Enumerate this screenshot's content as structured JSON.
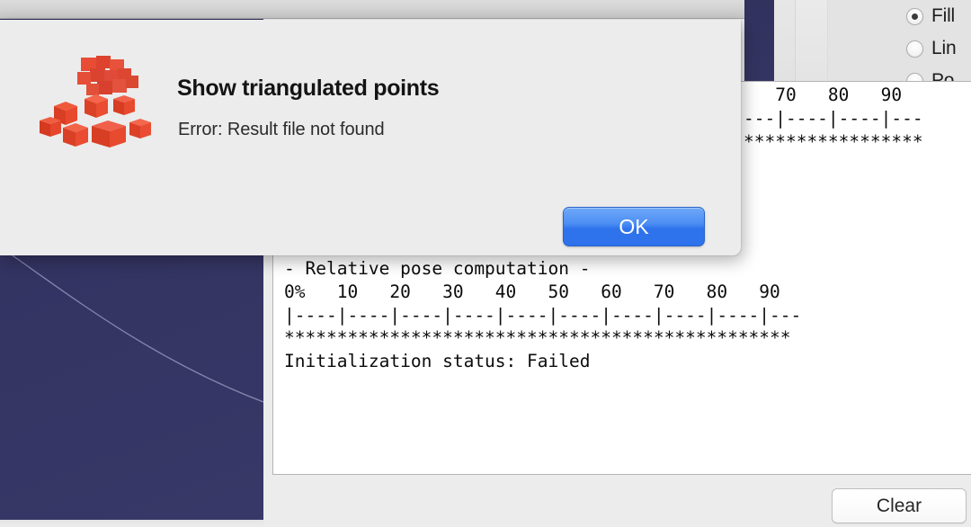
{
  "dialog": {
    "heading": "Show triangulated points",
    "message": "Error: Result file not found",
    "ok_label": "OK",
    "icon": "red-cubes-point-cloud-icon",
    "accent_color": "#2f73ec"
  },
  "console": {
    "text": "- Relative pose computation -\n0%   10   20   30   40   50   60   70   80   90\n|----|----|----|----|----|----|----|----|----|---\n************************************************\nInitialization status: Failed",
    "occluded_text": "   70   80   90\n---|----|----|---\n*****************",
    "lines": [
      "- Relative pose computation -",
      "0%   10   20   30   40   50   60   70   80   90",
      "|----|----|----|----|----|----|----|----|----|---",
      "************************************************",
      "Initialization status: Failed"
    ],
    "status_label": "Initialization status:",
    "status_value": "Failed"
  },
  "toolbar": {
    "clear_label": "Clear"
  },
  "render_options": {
    "items": [
      {
        "label": "Fill",
        "checked": true
      },
      {
        "label": "Lin",
        "checked": false
      },
      {
        "label": "Po",
        "checked": false
      }
    ]
  },
  "viewport": {
    "background_color": "#343463",
    "curve_color": "#9a9ac0"
  }
}
